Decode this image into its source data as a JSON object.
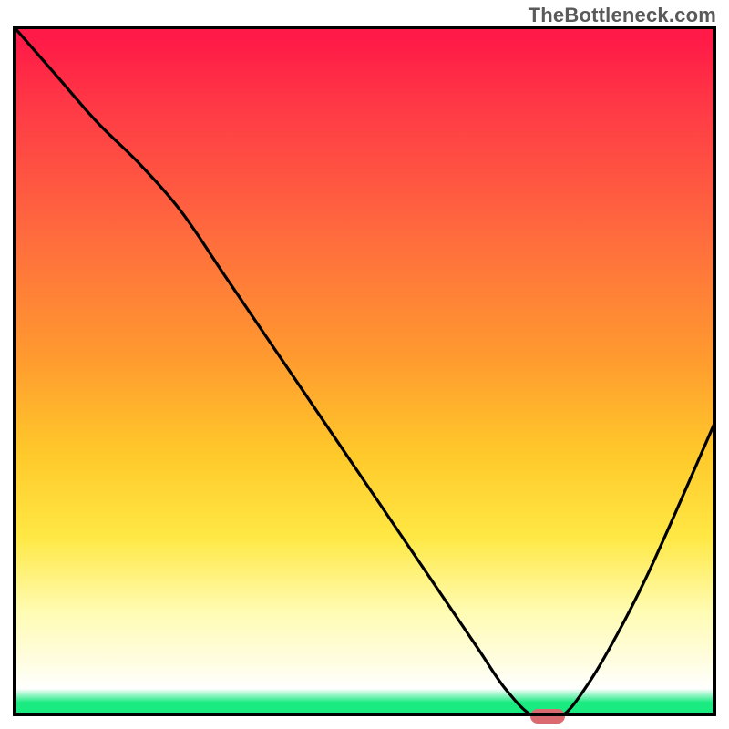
{
  "watermark": "TheBottleneck.com",
  "chart_data": {
    "type": "line",
    "title": "",
    "xlabel": "",
    "ylabel": "",
    "xlim": [
      0,
      100
    ],
    "ylim": [
      0,
      100
    ],
    "grid": false,
    "legend": false,
    "gradient_stops": [
      {
        "pos": 0,
        "color": "#ff1a47"
      },
      {
        "pos": 30,
        "color": "#ff6a3e"
      },
      {
        "pos": 62,
        "color": "#ffc92a"
      },
      {
        "pos": 85,
        "color": "#fffcb4"
      },
      {
        "pos": 96,
        "color": "#ffffff"
      },
      {
        "pos": 100,
        "color": "#19eb81"
      }
    ],
    "series": [
      {
        "name": "bottleneck-curve",
        "x": [
          0,
          6,
          12,
          18,
          24,
          30,
          36,
          42,
          48,
          54,
          60,
          66,
          70,
          74,
          78,
          82,
          86,
          90,
          94,
          100
        ],
        "y": [
          100,
          93,
          86,
          80,
          73,
          64,
          55,
          46,
          37,
          28,
          19,
          10,
          4,
          0,
          0,
          5,
          12,
          20,
          29,
          43
        ]
      }
    ],
    "marker": {
      "x": 76,
      "y": 0,
      "color": "#da6a6f"
    }
  }
}
